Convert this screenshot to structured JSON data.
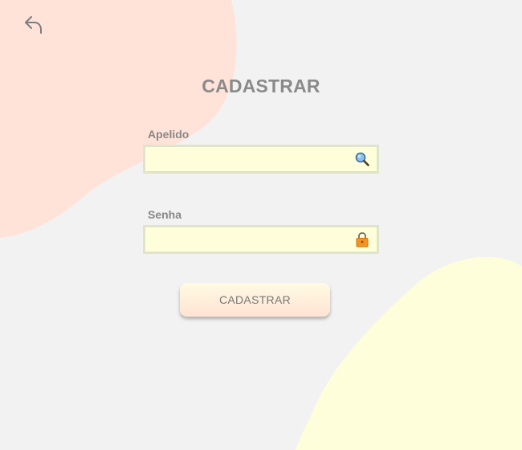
{
  "header": {
    "back_icon": "back-arrow-icon",
    "title": "CADASTRAR"
  },
  "form": {
    "nickname": {
      "label": "Apelido",
      "value": "",
      "placeholder": "",
      "icon": "magnifier-icon"
    },
    "password": {
      "label": "Senha",
      "value": "",
      "placeholder": "",
      "icon": "padlock-icon"
    },
    "submit_label": "CADASTRAR"
  },
  "colors": {
    "background": "#f2f2f2",
    "blob_top_left": "#ffe3d9",
    "blob_bottom_right": "#feffda",
    "field_background": "#feffda",
    "field_border": "#e0e4c8",
    "title_text": "#8a8a8a"
  }
}
